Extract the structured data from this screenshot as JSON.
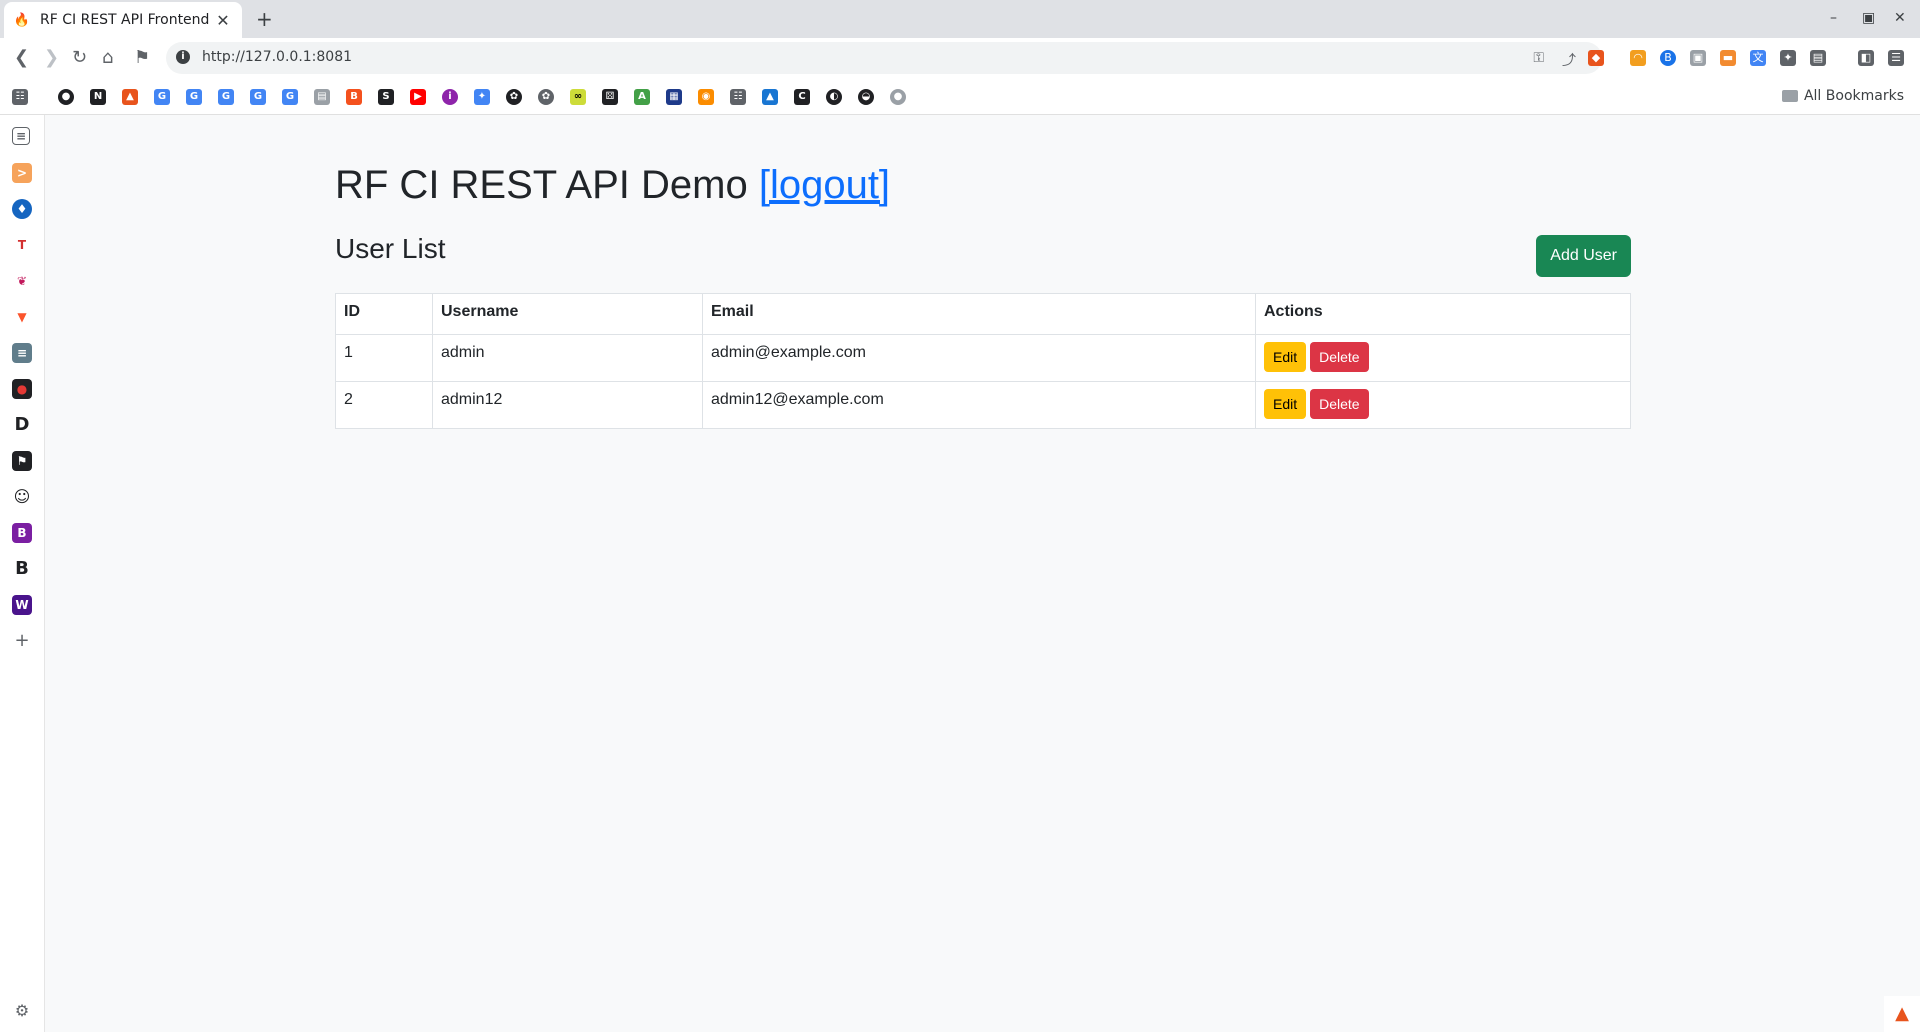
{
  "browser": {
    "tab_title": "RF CI REST API Frontend",
    "new_tab_label": "+",
    "url": "http://127.0.0.1:8081",
    "all_bookmarks_label": "All Bookmarks"
  },
  "page": {
    "title": "RF CI REST API Demo",
    "logout_link": "[logout]",
    "subtitle": "User List",
    "add_button": "Add User"
  },
  "table": {
    "headers": [
      "ID",
      "Username",
      "Email",
      "Actions"
    ],
    "rows": [
      {
        "id": "1",
        "username": "admin",
        "email": "admin@example.com",
        "edit": "Edit",
        "delete": "Delete"
      },
      {
        "id": "2",
        "username": "admin12",
        "email": "admin12@example.com",
        "edit": "Edit",
        "delete": "Delete"
      }
    ]
  },
  "colors": {
    "success": "#198754",
    "warning": "#ffc107",
    "danger": "#dc3545",
    "link": "#0d6efd"
  }
}
